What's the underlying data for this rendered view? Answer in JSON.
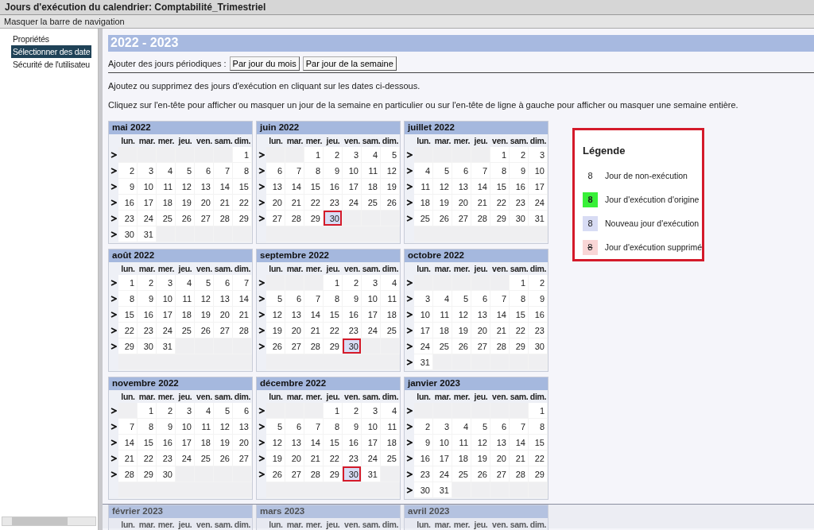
{
  "window": {
    "title": "Jours d'exécution du calendrier: Comptabilité_Trimestriel"
  },
  "nav_toggle": "Masquer la barre de navigation",
  "sidebar": {
    "items": [
      {
        "label": "Propriétés",
        "selected": false
      },
      {
        "label": "Sélectionner des date",
        "selected": true
      },
      {
        "label": "Sécurité de l'utilisateu",
        "selected": false
      }
    ]
  },
  "year_title": "2022 - 2023",
  "periodic": {
    "label": "Ajouter des jours périodiques :",
    "buttons": [
      "Par jour du mois",
      "Par jour de la semaine"
    ]
  },
  "instructions": [
    "Ajoutez ou supprimez des jours d'exécution en cliquant sur les dates ci-dessous.",
    "Cliquez sur l'en-tête pour afficher ou masquer un jour de la semaine en particulier ou sur l'en-tête de ligne à gauche pour afficher ou masquer une semaine entière."
  ],
  "months": [
    {
      "name": "mai 2022",
      "weekdays": [
        "lun.",
        "mar.",
        "mer.",
        "jeu.",
        "ven.",
        "sam.",
        "dim."
      ],
      "weeks": [
        [
          {
            "kind": "blank"
          },
          {
            "kind": "blank"
          },
          {
            "kind": "blank"
          },
          {
            "kind": "blank"
          },
          {
            "kind": "blank"
          },
          {
            "kind": "blank"
          },
          {
            "kind": "day",
            "day": "1"
          }
        ],
        [
          {
            "kind": "day",
            "day": "2"
          },
          {
            "kind": "day",
            "day": "3"
          },
          {
            "kind": "day",
            "day": "4"
          },
          {
            "kind": "day",
            "day": "5"
          },
          {
            "kind": "day",
            "day": "6"
          },
          {
            "kind": "day",
            "day": "7"
          },
          {
            "kind": "day",
            "day": "8"
          }
        ],
        [
          {
            "kind": "day",
            "day": "9"
          },
          {
            "kind": "day",
            "day": "10"
          },
          {
            "kind": "day",
            "day": "11"
          },
          {
            "kind": "day",
            "day": "12"
          },
          {
            "kind": "day",
            "day": "13"
          },
          {
            "kind": "day",
            "day": "14"
          },
          {
            "kind": "day",
            "day": "15"
          }
        ],
        [
          {
            "kind": "day",
            "day": "16"
          },
          {
            "kind": "day",
            "day": "17"
          },
          {
            "kind": "day",
            "day": "18"
          },
          {
            "kind": "day",
            "day": "19"
          },
          {
            "kind": "day",
            "day": "20"
          },
          {
            "kind": "day",
            "day": "21"
          },
          {
            "kind": "day",
            "day": "22"
          }
        ],
        [
          {
            "kind": "day",
            "day": "23"
          },
          {
            "kind": "day",
            "day": "24"
          },
          {
            "kind": "day",
            "day": "25"
          },
          {
            "kind": "day",
            "day": "26"
          },
          {
            "kind": "day",
            "day": "27"
          },
          {
            "kind": "day",
            "day": "28"
          },
          {
            "kind": "day",
            "day": "29"
          }
        ],
        [
          {
            "kind": "day",
            "day": "30"
          },
          {
            "kind": "day",
            "day": "31"
          },
          {
            "kind": "blank"
          },
          {
            "kind": "blank"
          },
          {
            "kind": "blank"
          },
          {
            "kind": "blank"
          },
          {
            "kind": "blank"
          }
        ]
      ]
    },
    {
      "name": "juin 2022",
      "weekdays": [
        "lun.",
        "mar.",
        "mer.",
        "jeu.",
        "ven.",
        "sam.",
        "dim."
      ],
      "weeks": [
        [
          {
            "kind": "blank"
          },
          {
            "kind": "blank"
          },
          {
            "kind": "day",
            "day": "1"
          },
          {
            "kind": "day",
            "day": "2"
          },
          {
            "kind": "day",
            "day": "3"
          },
          {
            "kind": "day",
            "day": "4"
          },
          {
            "kind": "day",
            "day": "5"
          }
        ],
        [
          {
            "kind": "day",
            "day": "6"
          },
          {
            "kind": "day",
            "day": "7"
          },
          {
            "kind": "day",
            "day": "8"
          },
          {
            "kind": "day",
            "day": "9"
          },
          {
            "kind": "day",
            "day": "10"
          },
          {
            "kind": "day",
            "day": "11"
          },
          {
            "kind": "day",
            "day": "12"
          }
        ],
        [
          {
            "kind": "day",
            "day": "13"
          },
          {
            "kind": "day",
            "day": "14"
          },
          {
            "kind": "day",
            "day": "15"
          },
          {
            "kind": "day",
            "day": "16"
          },
          {
            "kind": "day",
            "day": "17"
          },
          {
            "kind": "day",
            "day": "18"
          },
          {
            "kind": "day",
            "day": "19"
          }
        ],
        [
          {
            "kind": "day",
            "day": "20"
          },
          {
            "kind": "day",
            "day": "21"
          },
          {
            "kind": "day",
            "day": "22"
          },
          {
            "kind": "day",
            "day": "23"
          },
          {
            "kind": "day",
            "day": "24"
          },
          {
            "kind": "day",
            "day": "25"
          },
          {
            "kind": "day",
            "day": "26"
          }
        ],
        [
          {
            "kind": "day",
            "day": "27"
          },
          {
            "kind": "day",
            "day": "28"
          },
          {
            "kind": "day",
            "day": "29"
          },
          {
            "kind": "new",
            "day": "30",
            "outlined": true
          },
          {
            "kind": "blank"
          },
          {
            "kind": "blank"
          },
          {
            "kind": "blank"
          }
        ]
      ]
    },
    {
      "name": "juillet 2022",
      "weekdays": [
        "lun.",
        "mar.",
        "mer.",
        "jeu.",
        "ven.",
        "sam.",
        "dim."
      ],
      "weeks": [
        [
          {
            "kind": "blank"
          },
          {
            "kind": "blank"
          },
          {
            "kind": "blank"
          },
          {
            "kind": "blank"
          },
          {
            "kind": "day",
            "day": "1"
          },
          {
            "kind": "day",
            "day": "2"
          },
          {
            "kind": "day",
            "day": "3"
          }
        ],
        [
          {
            "kind": "day",
            "day": "4"
          },
          {
            "kind": "day",
            "day": "5"
          },
          {
            "kind": "day",
            "day": "6"
          },
          {
            "kind": "day",
            "day": "7"
          },
          {
            "kind": "day",
            "day": "8"
          },
          {
            "kind": "day",
            "day": "9"
          },
          {
            "kind": "day",
            "day": "10"
          }
        ],
        [
          {
            "kind": "day",
            "day": "11"
          },
          {
            "kind": "day",
            "day": "12"
          },
          {
            "kind": "day",
            "day": "13"
          },
          {
            "kind": "day",
            "day": "14"
          },
          {
            "kind": "day",
            "day": "15"
          },
          {
            "kind": "day",
            "day": "16"
          },
          {
            "kind": "day",
            "day": "17"
          }
        ],
        [
          {
            "kind": "day",
            "day": "18"
          },
          {
            "kind": "day",
            "day": "19"
          },
          {
            "kind": "day",
            "day": "20"
          },
          {
            "kind": "day",
            "day": "21"
          },
          {
            "kind": "day",
            "day": "22"
          },
          {
            "kind": "day",
            "day": "23"
          },
          {
            "kind": "day",
            "day": "24"
          }
        ],
        [
          {
            "kind": "day",
            "day": "25"
          },
          {
            "kind": "day",
            "day": "26"
          },
          {
            "kind": "day",
            "day": "27"
          },
          {
            "kind": "day",
            "day": "28"
          },
          {
            "kind": "day",
            "day": "29"
          },
          {
            "kind": "day",
            "day": "30"
          },
          {
            "kind": "day",
            "day": "31"
          }
        ]
      ]
    },
    {
      "name": "août 2022",
      "weekdays": [
        "lun.",
        "mar.",
        "mer.",
        "jeu.",
        "ven.",
        "sam.",
        "dim."
      ],
      "weeks": [
        [
          {
            "kind": "day",
            "day": "1"
          },
          {
            "kind": "day",
            "day": "2"
          },
          {
            "kind": "day",
            "day": "3"
          },
          {
            "kind": "day",
            "day": "4"
          },
          {
            "kind": "day",
            "day": "5"
          },
          {
            "kind": "day",
            "day": "6"
          },
          {
            "kind": "day",
            "day": "7"
          }
        ],
        [
          {
            "kind": "day",
            "day": "8"
          },
          {
            "kind": "day",
            "day": "9"
          },
          {
            "kind": "day",
            "day": "10"
          },
          {
            "kind": "day",
            "day": "11"
          },
          {
            "kind": "day",
            "day": "12"
          },
          {
            "kind": "day",
            "day": "13"
          },
          {
            "kind": "day",
            "day": "14"
          }
        ],
        [
          {
            "kind": "day",
            "day": "15"
          },
          {
            "kind": "day",
            "day": "16"
          },
          {
            "kind": "day",
            "day": "17"
          },
          {
            "kind": "day",
            "day": "18"
          },
          {
            "kind": "day",
            "day": "19"
          },
          {
            "kind": "day",
            "day": "20"
          },
          {
            "kind": "day",
            "day": "21"
          }
        ],
        [
          {
            "kind": "day",
            "day": "22"
          },
          {
            "kind": "day",
            "day": "23"
          },
          {
            "kind": "day",
            "day": "24"
          },
          {
            "kind": "day",
            "day": "25"
          },
          {
            "kind": "day",
            "day": "26"
          },
          {
            "kind": "day",
            "day": "27"
          },
          {
            "kind": "day",
            "day": "28"
          }
        ],
        [
          {
            "kind": "day",
            "day": "29"
          },
          {
            "kind": "day",
            "day": "30"
          },
          {
            "kind": "day",
            "day": "31"
          },
          {
            "kind": "blank"
          },
          {
            "kind": "blank"
          },
          {
            "kind": "blank"
          },
          {
            "kind": "blank"
          }
        ]
      ]
    },
    {
      "name": "septembre 2022",
      "weekdays": [
        "lun.",
        "mar.",
        "mer.",
        "jeu.",
        "ven.",
        "sam.",
        "dim."
      ],
      "weeks": [
        [
          {
            "kind": "blank"
          },
          {
            "kind": "blank"
          },
          {
            "kind": "blank"
          },
          {
            "kind": "day",
            "day": "1"
          },
          {
            "kind": "day",
            "day": "2"
          },
          {
            "kind": "day",
            "day": "3"
          },
          {
            "kind": "day",
            "day": "4"
          }
        ],
        [
          {
            "kind": "day",
            "day": "5"
          },
          {
            "kind": "day",
            "day": "6"
          },
          {
            "kind": "day",
            "day": "7"
          },
          {
            "kind": "day",
            "day": "8"
          },
          {
            "kind": "day",
            "day": "9"
          },
          {
            "kind": "day",
            "day": "10"
          },
          {
            "kind": "day",
            "day": "11"
          }
        ],
        [
          {
            "kind": "day",
            "day": "12"
          },
          {
            "kind": "day",
            "day": "13"
          },
          {
            "kind": "day",
            "day": "14"
          },
          {
            "kind": "day",
            "day": "15"
          },
          {
            "kind": "day",
            "day": "16"
          },
          {
            "kind": "day",
            "day": "17"
          },
          {
            "kind": "day",
            "day": "18"
          }
        ],
        [
          {
            "kind": "day",
            "day": "19"
          },
          {
            "kind": "day",
            "day": "20"
          },
          {
            "kind": "day",
            "day": "21"
          },
          {
            "kind": "day",
            "day": "22"
          },
          {
            "kind": "day",
            "day": "23"
          },
          {
            "kind": "day",
            "day": "24"
          },
          {
            "kind": "day",
            "day": "25"
          }
        ],
        [
          {
            "kind": "day",
            "day": "26"
          },
          {
            "kind": "day",
            "day": "27"
          },
          {
            "kind": "day",
            "day": "28"
          },
          {
            "kind": "day",
            "day": "29"
          },
          {
            "kind": "new",
            "day": "30",
            "outlined": true
          },
          {
            "kind": "blank"
          },
          {
            "kind": "blank"
          }
        ]
      ]
    },
    {
      "name": "octobre 2022",
      "weekdays": [
        "lun.",
        "mar.",
        "mer.",
        "jeu.",
        "ven.",
        "sam.",
        "dim."
      ],
      "weeks": [
        [
          {
            "kind": "blank"
          },
          {
            "kind": "blank"
          },
          {
            "kind": "blank"
          },
          {
            "kind": "blank"
          },
          {
            "kind": "blank"
          },
          {
            "kind": "day",
            "day": "1"
          },
          {
            "kind": "day",
            "day": "2"
          }
        ],
        [
          {
            "kind": "day",
            "day": "3"
          },
          {
            "kind": "day",
            "day": "4"
          },
          {
            "kind": "day",
            "day": "5"
          },
          {
            "kind": "day",
            "day": "6"
          },
          {
            "kind": "day",
            "day": "7"
          },
          {
            "kind": "day",
            "day": "8"
          },
          {
            "kind": "day",
            "day": "9"
          }
        ],
        [
          {
            "kind": "day",
            "day": "10"
          },
          {
            "kind": "day",
            "day": "11"
          },
          {
            "kind": "day",
            "day": "12"
          },
          {
            "kind": "day",
            "day": "13"
          },
          {
            "kind": "day",
            "day": "14"
          },
          {
            "kind": "day",
            "day": "15"
          },
          {
            "kind": "day",
            "day": "16"
          }
        ],
        [
          {
            "kind": "day",
            "day": "17"
          },
          {
            "kind": "day",
            "day": "18"
          },
          {
            "kind": "day",
            "day": "19"
          },
          {
            "kind": "day",
            "day": "20"
          },
          {
            "kind": "day",
            "day": "21"
          },
          {
            "kind": "day",
            "day": "22"
          },
          {
            "kind": "day",
            "day": "23"
          }
        ],
        [
          {
            "kind": "day",
            "day": "24"
          },
          {
            "kind": "day",
            "day": "25"
          },
          {
            "kind": "day",
            "day": "26"
          },
          {
            "kind": "day",
            "day": "27"
          },
          {
            "kind": "day",
            "day": "28"
          },
          {
            "kind": "day",
            "day": "29"
          },
          {
            "kind": "day",
            "day": "30"
          }
        ],
        [
          {
            "kind": "day",
            "day": "31"
          },
          {
            "kind": "blank"
          },
          {
            "kind": "blank"
          },
          {
            "kind": "blank"
          },
          {
            "kind": "blank"
          },
          {
            "kind": "blank"
          },
          {
            "kind": "blank"
          }
        ]
      ]
    },
    {
      "name": "novembre 2022",
      "weekdays": [
        "lun.",
        "mar.",
        "mer.",
        "jeu.",
        "ven.",
        "sam.",
        "dim."
      ],
      "weeks": [
        [
          {
            "kind": "blank"
          },
          {
            "kind": "day",
            "day": "1"
          },
          {
            "kind": "day",
            "day": "2"
          },
          {
            "kind": "day",
            "day": "3"
          },
          {
            "kind": "day",
            "day": "4"
          },
          {
            "kind": "day",
            "day": "5"
          },
          {
            "kind": "day",
            "day": "6"
          }
        ],
        [
          {
            "kind": "day",
            "day": "7"
          },
          {
            "kind": "day",
            "day": "8"
          },
          {
            "kind": "day",
            "day": "9"
          },
          {
            "kind": "day",
            "day": "10"
          },
          {
            "kind": "day",
            "day": "11"
          },
          {
            "kind": "day",
            "day": "12"
          },
          {
            "kind": "day",
            "day": "13"
          }
        ],
        [
          {
            "kind": "day",
            "day": "14"
          },
          {
            "kind": "day",
            "day": "15"
          },
          {
            "kind": "day",
            "day": "16"
          },
          {
            "kind": "day",
            "day": "17"
          },
          {
            "kind": "day",
            "day": "18"
          },
          {
            "kind": "day",
            "day": "19"
          },
          {
            "kind": "day",
            "day": "20"
          }
        ],
        [
          {
            "kind": "day",
            "day": "21"
          },
          {
            "kind": "day",
            "day": "22"
          },
          {
            "kind": "day",
            "day": "23"
          },
          {
            "kind": "day",
            "day": "24"
          },
          {
            "kind": "day",
            "day": "25"
          },
          {
            "kind": "day",
            "day": "26"
          },
          {
            "kind": "day",
            "day": "27"
          }
        ],
        [
          {
            "kind": "day",
            "day": "28"
          },
          {
            "kind": "day",
            "day": "29"
          },
          {
            "kind": "day",
            "day": "30"
          },
          {
            "kind": "blank"
          },
          {
            "kind": "blank"
          },
          {
            "kind": "blank"
          },
          {
            "kind": "blank"
          }
        ]
      ]
    },
    {
      "name": "décembre 2022",
      "weekdays": [
        "lun.",
        "mar.",
        "mer.",
        "jeu.",
        "ven.",
        "sam.",
        "dim."
      ],
      "weeks": [
        [
          {
            "kind": "blank"
          },
          {
            "kind": "blank"
          },
          {
            "kind": "blank"
          },
          {
            "kind": "day",
            "day": "1"
          },
          {
            "kind": "day",
            "day": "2"
          },
          {
            "kind": "day",
            "day": "3"
          },
          {
            "kind": "day",
            "day": "4"
          }
        ],
        [
          {
            "kind": "day",
            "day": "5"
          },
          {
            "kind": "day",
            "day": "6"
          },
          {
            "kind": "day",
            "day": "7"
          },
          {
            "kind": "day",
            "day": "8"
          },
          {
            "kind": "day",
            "day": "9"
          },
          {
            "kind": "day",
            "day": "10"
          },
          {
            "kind": "day",
            "day": "11"
          }
        ],
        [
          {
            "kind": "day",
            "day": "12"
          },
          {
            "kind": "day",
            "day": "13"
          },
          {
            "kind": "day",
            "day": "14"
          },
          {
            "kind": "day",
            "day": "15"
          },
          {
            "kind": "day",
            "day": "16"
          },
          {
            "kind": "day",
            "day": "17"
          },
          {
            "kind": "day",
            "day": "18"
          }
        ],
        [
          {
            "kind": "day",
            "day": "19"
          },
          {
            "kind": "day",
            "day": "20"
          },
          {
            "kind": "day",
            "day": "21"
          },
          {
            "kind": "day",
            "day": "22"
          },
          {
            "kind": "day",
            "day": "23"
          },
          {
            "kind": "day",
            "day": "24"
          },
          {
            "kind": "day",
            "day": "25"
          }
        ],
        [
          {
            "kind": "day",
            "day": "26"
          },
          {
            "kind": "day",
            "day": "27"
          },
          {
            "kind": "day",
            "day": "28"
          },
          {
            "kind": "day",
            "day": "29"
          },
          {
            "kind": "new",
            "day": "30",
            "outlined": true
          },
          {
            "kind": "day",
            "day": "31"
          },
          {
            "kind": "blank"
          }
        ]
      ]
    },
    {
      "name": "janvier 2023",
      "weekdays": [
        "lun.",
        "mar.",
        "mer.",
        "jeu.",
        "ven.",
        "sam.",
        "dim."
      ],
      "weeks": [
        [
          {
            "kind": "blank"
          },
          {
            "kind": "blank"
          },
          {
            "kind": "blank"
          },
          {
            "kind": "blank"
          },
          {
            "kind": "blank"
          },
          {
            "kind": "blank"
          },
          {
            "kind": "day",
            "day": "1"
          }
        ],
        [
          {
            "kind": "day",
            "day": "2"
          },
          {
            "kind": "day",
            "day": "3"
          },
          {
            "kind": "day",
            "day": "4"
          },
          {
            "kind": "day",
            "day": "5"
          },
          {
            "kind": "day",
            "day": "6"
          },
          {
            "kind": "day",
            "day": "7"
          },
          {
            "kind": "day",
            "day": "8"
          }
        ],
        [
          {
            "kind": "day",
            "day": "9"
          },
          {
            "kind": "day",
            "day": "10"
          },
          {
            "kind": "day",
            "day": "11"
          },
          {
            "kind": "day",
            "day": "12"
          },
          {
            "kind": "day",
            "day": "13"
          },
          {
            "kind": "day",
            "day": "14"
          },
          {
            "kind": "day",
            "day": "15"
          }
        ],
        [
          {
            "kind": "day",
            "day": "16"
          },
          {
            "kind": "day",
            "day": "17"
          },
          {
            "kind": "day",
            "day": "18"
          },
          {
            "kind": "day",
            "day": "19"
          },
          {
            "kind": "day",
            "day": "20"
          },
          {
            "kind": "day",
            "day": "21"
          },
          {
            "kind": "day",
            "day": "22"
          }
        ],
        [
          {
            "kind": "day",
            "day": "23"
          },
          {
            "kind": "day",
            "day": "24"
          },
          {
            "kind": "day",
            "day": "25"
          },
          {
            "kind": "day",
            "day": "26"
          },
          {
            "kind": "day",
            "day": "27"
          },
          {
            "kind": "day",
            "day": "28"
          },
          {
            "kind": "day",
            "day": "29"
          }
        ],
        [
          {
            "kind": "day",
            "day": "30"
          },
          {
            "kind": "day",
            "day": "31"
          },
          {
            "kind": "blank"
          },
          {
            "kind": "blank"
          },
          {
            "kind": "blank"
          },
          {
            "kind": "blank"
          },
          {
            "kind": "blank"
          }
        ]
      ]
    },
    {
      "name": "février 2023",
      "weekdays": [
        "lun.",
        "mar.",
        "mer.",
        "jeu.",
        "ven.",
        "sam.",
        "dim."
      ]
    },
    {
      "name": "mars 2023",
      "weekdays": [
        "lun.",
        "mar.",
        "mer.",
        "jeu.",
        "ven.",
        "sam.",
        "dim."
      ]
    },
    {
      "name": "avril 2023",
      "weekdays": [
        "lun.",
        "mar.",
        "mer.",
        "jeu.",
        "ven.",
        "sam.",
        "dim."
      ]
    }
  ],
  "legend": {
    "title": "Légende",
    "items": [
      {
        "kind": "non_execution",
        "sample": "8",
        "label": "Jour de non-exécution"
      },
      {
        "kind": "original",
        "sample": "8",
        "label": "Jour d'exécution d'origine"
      },
      {
        "kind": "new",
        "sample": "8",
        "label": "Nouveau jour d'exécution"
      },
      {
        "kind": "removed",
        "sample": "8",
        "label": "Jour d'exécution supprimé"
      }
    ]
  }
}
